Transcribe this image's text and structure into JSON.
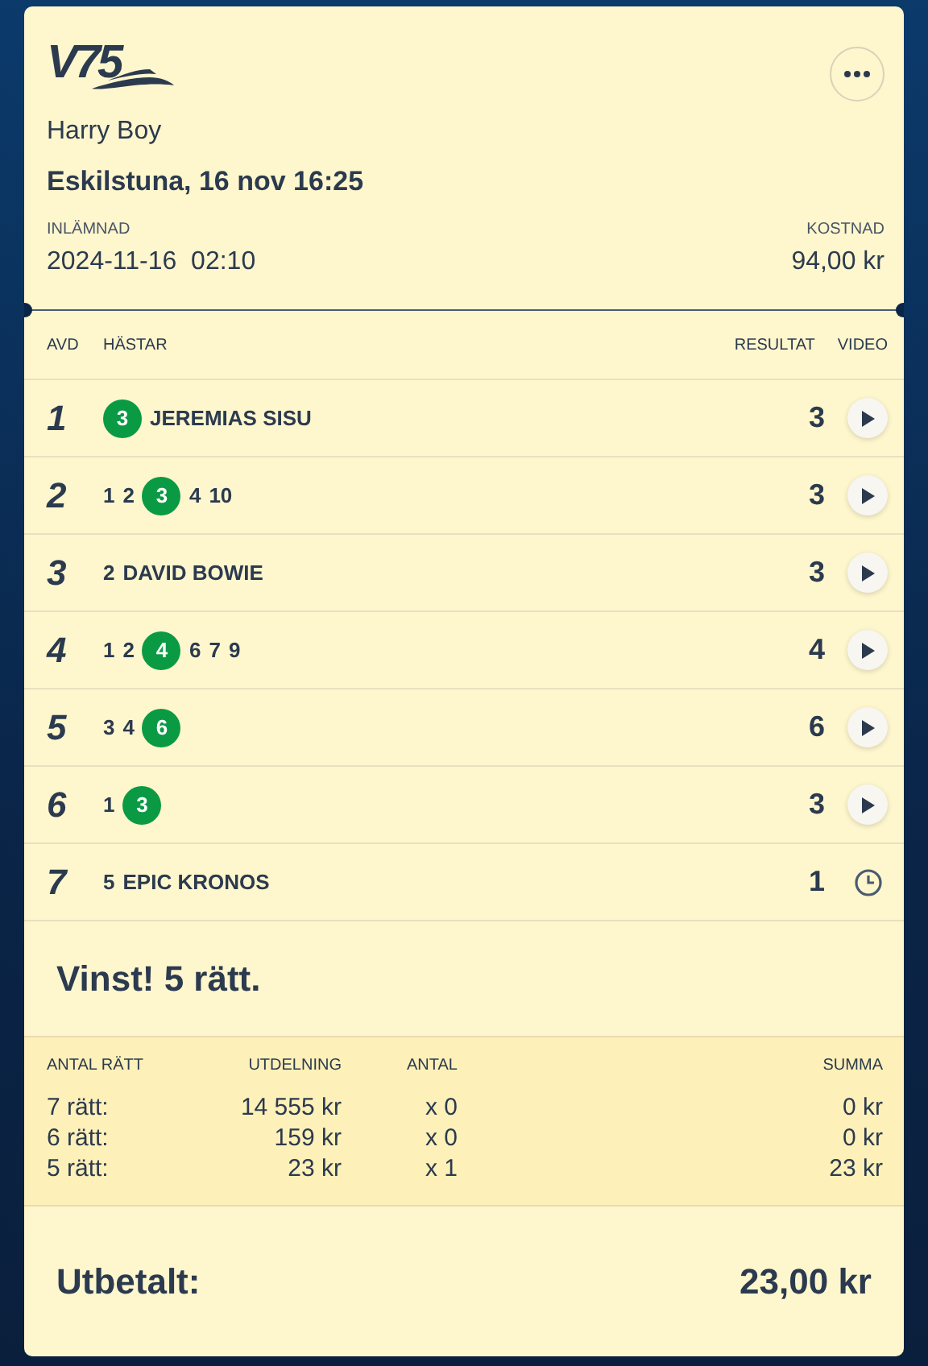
{
  "logo": "V75",
  "player": "Harry Boy",
  "race": "Eskilstuna, 16 nov 16:25",
  "submitted": {
    "label": "INLÄMNAD",
    "value": "2024-11-16  02:10"
  },
  "cost": {
    "label": "KOSTNAD",
    "value": "94,00 kr"
  },
  "columns": [
    "AVD",
    "HÄSTAR",
    "RESULTAT",
    "VIDEO"
  ],
  "legs": [
    {
      "avd": "1",
      "horses": [
        {
          "number": "3",
          "name": "JEREMIAS SISU",
          "winner": true
        }
      ],
      "result": "3",
      "kind": "play"
    },
    {
      "avd": "2",
      "horses": [
        {
          "number": "1",
          "winner": false
        },
        {
          "number": "2",
          "winner": false
        },
        {
          "number": "3",
          "winner": true
        },
        {
          "number": "4",
          "winner": false
        },
        {
          "number": "10",
          "winner": false
        }
      ],
      "result": "3",
      "kind": "play"
    },
    {
      "avd": "3",
      "horses": [
        {
          "number": "2",
          "name": "DAVID BOWIE",
          "winner": false
        }
      ],
      "result": "3",
      "kind": "play"
    },
    {
      "avd": "4",
      "horses": [
        {
          "number": "1",
          "winner": false
        },
        {
          "number": "2",
          "winner": false
        },
        {
          "number": "4",
          "winner": true
        },
        {
          "number": "6",
          "winner": false
        },
        {
          "number": "7",
          "winner": false
        },
        {
          "number": "9",
          "winner": false
        }
      ],
      "result": "4",
      "kind": "play"
    },
    {
      "avd": "5",
      "horses": [
        {
          "number": "3",
          "winner": false
        },
        {
          "number": "4",
          "winner": false
        },
        {
          "number": "6",
          "winner": true
        }
      ],
      "result": "6",
      "kind": "play"
    },
    {
      "avd": "6",
      "horses": [
        {
          "number": "1",
          "winner": false
        },
        {
          "number": "3",
          "winner": true
        }
      ],
      "result": "3",
      "kind": "play"
    },
    {
      "avd": "7",
      "horses": [
        {
          "number": "5",
          "name": "EPIC KRONOS",
          "winner": false
        }
      ],
      "result": "1",
      "kind": "pending"
    }
  ],
  "win_message": "Vinst! 5 rätt.",
  "payout_table": {
    "columns": [
      "ANTAL RÄTT",
      "UTDELNING",
      "ANTAL",
      "SUMMA"
    ],
    "rows": [
      [
        "7 rätt:",
        "14 555 kr",
        "x 0",
        "0 kr"
      ],
      [
        "6 rätt:",
        "159 kr",
        "x 0",
        "0 kr"
      ],
      [
        "5 rätt:",
        "23 kr",
        "x 1",
        "23 kr"
      ]
    ]
  },
  "total": {
    "label": "Utbetalt:",
    "value": "23,00 kr"
  }
}
